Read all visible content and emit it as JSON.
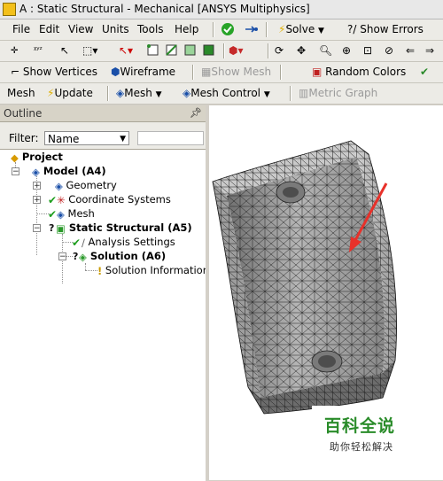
{
  "window": {
    "title": "A : Static Structural - Mechanical [ANSYS Multiphysics]"
  },
  "menubar": {
    "items": [
      "File",
      "Edit",
      "View",
      "Units",
      "Tools",
      "Help"
    ],
    "solve_label": "Solve",
    "show_errors_label": "?/ Show Errors"
  },
  "toolbar2": {
    "show_vertices": "Show Vertices",
    "wireframe": "Wireframe",
    "show_mesh": "Show Mesh",
    "random_colors": "Random Colors"
  },
  "toolbar3": {
    "mesh": "Mesh",
    "update": "Update",
    "mesh_dropdown": "Mesh",
    "mesh_control": "Mesh Control",
    "metric_graph": "Metric Graph"
  },
  "outline": {
    "title": "Outline",
    "filter_label": "Filter:",
    "filter_value": "Name",
    "tree": {
      "project": "Project",
      "model": "Model (A4)",
      "geometry": "Geometry",
      "coordinate_systems": "Coordinate Systems",
      "mesh": "Mesh",
      "static_structural": "Static Structural (A5)",
      "analysis_settings": "Analysis Settings",
      "solution": "Solution (A6)",
      "solution_information": "Solution Information"
    }
  },
  "watermark": {
    "title": "百科全说",
    "subtitle": "助你轻松解决"
  },
  "colors": {
    "check_green": "#1e9e1e",
    "annotation_arrow": "#e8312a",
    "mesh_fill": "#a6a6a6"
  }
}
